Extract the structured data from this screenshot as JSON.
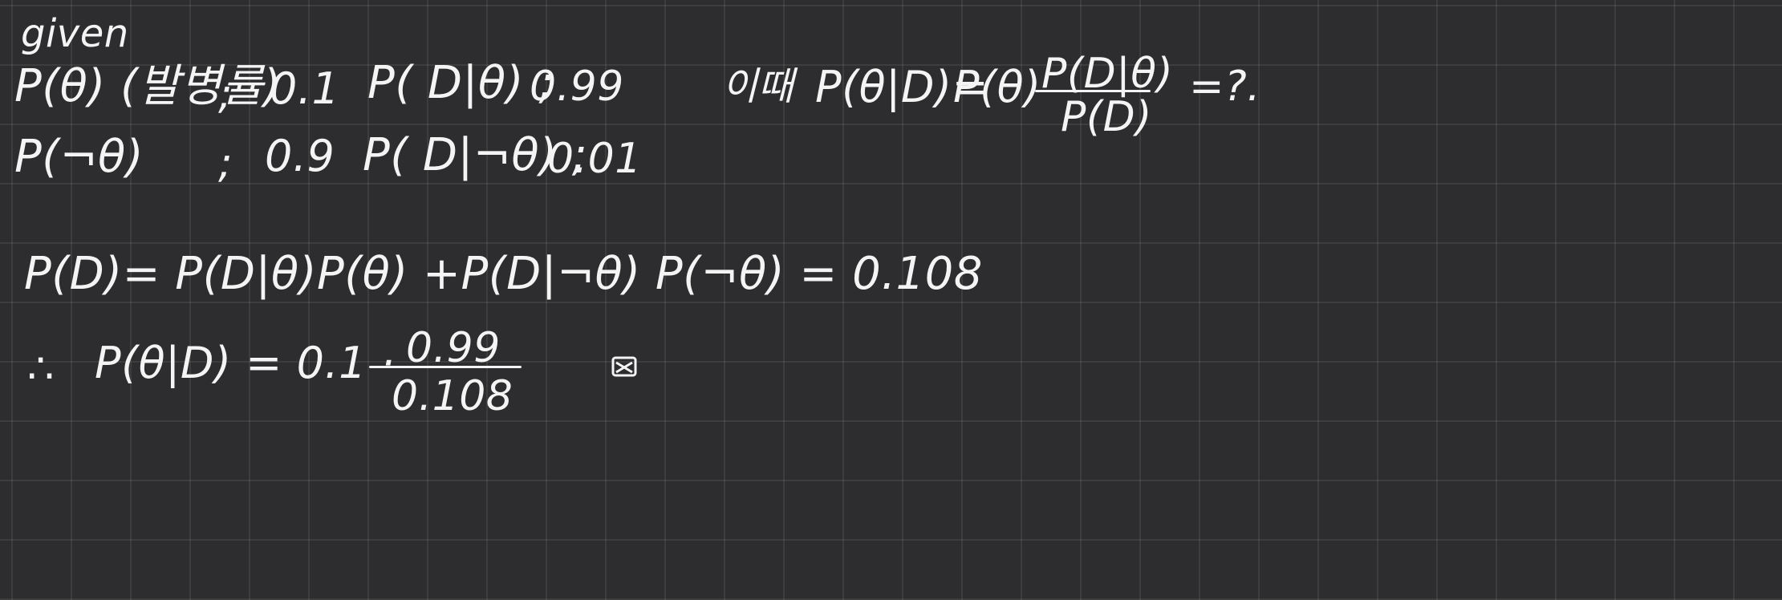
{
  "header": {
    "given": "given"
  },
  "given": {
    "p_theta": {
      "label": "P(θ) (발병률)",
      "sep": ";",
      "value": "0.1",
      "cond_label": "P( D|θ) ;",
      "cond_value": "0.99"
    },
    "p_not_theta": {
      "label": "P(¬θ)",
      "sep": ";",
      "value": "0.9",
      "cond_label": "P( D|¬θ) ;",
      "cond_value": "0.01"
    }
  },
  "question": {
    "prefix": "이때",
    "lhs": "P(θ|D)=",
    "term": "P(θ)",
    "numerator": "P(D|θ)",
    "denominator": "P(D)",
    "suffix": "=?."
  },
  "step1": {
    "text": "P(D)= P(D|θ)P(θ) +P(D|¬θ) P(¬θ) = 0.108"
  },
  "step2": {
    "therefore": "∴",
    "lhs": "P(θ|D) = 0.1 ·",
    "numerator": "0.99",
    "denominator": "0.108"
  },
  "mark": {
    "icon": "done-mark-icon"
  },
  "colors": {
    "background": "#2d2d2f",
    "grid": "#3e3e40",
    "ink": "#f4f4f4"
  }
}
